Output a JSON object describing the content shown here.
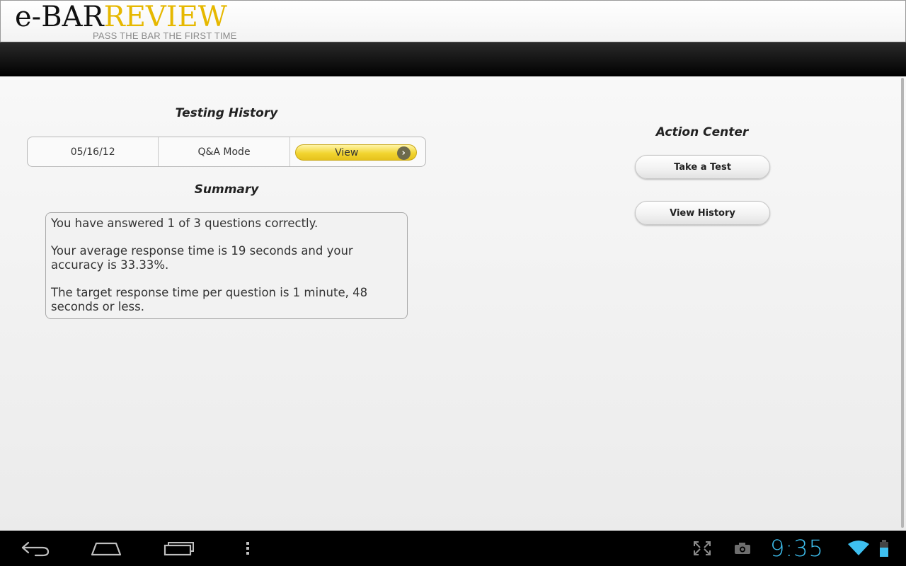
{
  "header": {
    "logo_part1": "e-BAR",
    "logo_part2": "REVIEW",
    "tagline": "PASS THE BAR THE FIRST TIME"
  },
  "testing_history": {
    "title": "Testing History",
    "rows": [
      {
        "date": "05/16/12",
        "mode": "Q&A Mode",
        "action_label": "View"
      }
    ]
  },
  "summary": {
    "title": "Summary",
    "paragraphs": [
      "You have answered 1 of 3 questions correctly.",
      "Your average response time is 19 seconds and your accuracy is 33.33%.",
      "The target response time per question is 1 minute, 48 seconds or less."
    ]
  },
  "action_center": {
    "title": "Action Center",
    "take_test_label": "Take a Test",
    "view_history_label": "View History"
  },
  "system_bar": {
    "time": "9:35",
    "icons": [
      "back-icon",
      "home-icon",
      "recent-apps-icon",
      "menu-icon",
      "fullscreen-icon",
      "camera-icon",
      "wifi-icon",
      "battery-icon"
    ]
  },
  "colors": {
    "logo_accent": "#e6b800",
    "view_button": "#f2d530",
    "clock": "#3ec0f0",
    "topbar": "#0d0d0d"
  }
}
